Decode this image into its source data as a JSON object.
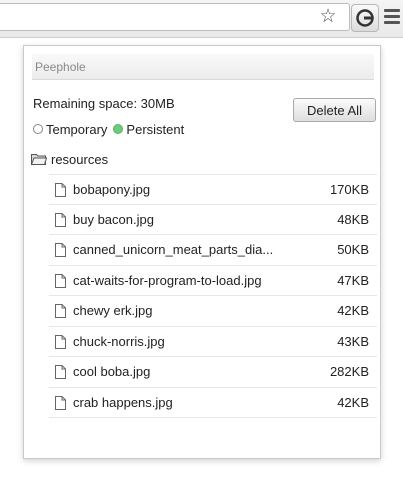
{
  "toolbar": {
    "bookmark_icon": "star-icon",
    "extension_icon": "peephole-extension-icon",
    "menu_icon": "wrench-menu-icon"
  },
  "popup": {
    "title": "Peephole",
    "remaining_space": "Remaining space: 30MB",
    "delete_all_label": "Delete All",
    "storage": {
      "options": [
        {
          "label": "Temporary",
          "selected": false
        },
        {
          "label": "Persistent",
          "selected": true
        }
      ],
      "selected_color": "#6ccc7a"
    },
    "folder": {
      "name": "resources",
      "icon": "folder-open-icon"
    },
    "files": [
      {
        "name": "bobapony.jpg",
        "size": "170KB"
      },
      {
        "name": "buy bacon.jpg",
        "size": "48KB"
      },
      {
        "name": "canned_unicorn_meat_parts_dia...",
        "size": "50KB"
      },
      {
        "name": "cat-waits-for-program-to-load.jpg",
        "size": "47KB"
      },
      {
        "name": "chewy erk.jpg",
        "size": "42KB"
      },
      {
        "name": "chuck-norris.jpg",
        "size": "43KB"
      },
      {
        "name": "cool boba.jpg",
        "size": "282KB"
      },
      {
        "name": "crab happens.jpg",
        "size": "42KB"
      }
    ]
  }
}
